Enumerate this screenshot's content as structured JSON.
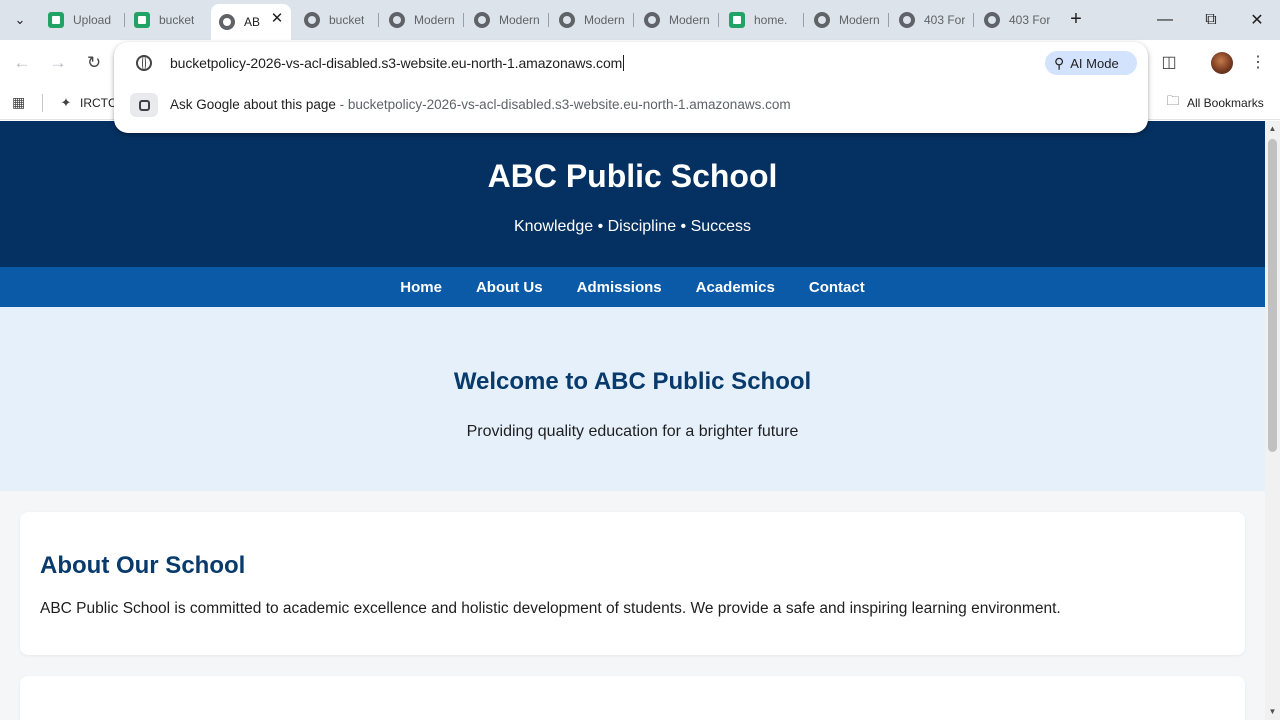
{
  "tabs": [
    {
      "label": "Upload",
      "favicon": "sheet-icon"
    },
    {
      "label": "bucket",
      "favicon": "sheet-icon"
    },
    {
      "label": "AB",
      "favicon": "globe-icon",
      "active": true
    },
    {
      "label": "bucket",
      "favicon": "globe-icon"
    },
    {
      "label": "Modern",
      "favicon": "globe-icon"
    },
    {
      "label": "Modern",
      "favicon": "globe-icon"
    },
    {
      "label": "Modern",
      "favicon": "globe-icon"
    },
    {
      "label": "Modern",
      "favicon": "globe-icon"
    },
    {
      "label": "home.",
      "favicon": "sheet-icon"
    },
    {
      "label": "Modern",
      "favicon": "globe-icon"
    },
    {
      "label": "403 For",
      "favicon": "globe-icon"
    },
    {
      "label": "403 For",
      "favicon": "globe-icon"
    }
  ],
  "omnibox": {
    "url": "bucketpolicy-2026-vs-acl-disabled.s3-website.eu-north-1.amazonaws.com",
    "ai_mode_label": "AI Mode",
    "suggestion_prefix": "Ask Google about this page",
    "suggestion_separator": " - ",
    "suggestion_url": "bucketpolicy-2026-vs-acl-disabled.s3-website.eu-north-1.amazonaws.com"
  },
  "bookmarks": {
    "items": [
      {
        "label": "IRCTC"
      }
    ],
    "all_bookmarks_label": "All Bookmarks"
  },
  "page": {
    "header": {
      "title": "ABC Public School",
      "tagline": "Knowledge • Discipline • Success"
    },
    "nav": [
      "Home",
      "About Us",
      "Admissions",
      "Academics",
      "Contact"
    ],
    "hero": {
      "title": "Welcome to ABC Public School",
      "subtitle": "Providing quality education for a brighter future"
    },
    "about": {
      "title": "About Our School",
      "text": "ABC Public School is committed to academic excellence and holistic development of students. We provide a safe and inspiring learning environment."
    }
  },
  "colors": {
    "header_bg": "#053162",
    "nav_bg": "#0a5aa8",
    "hero_bg": "#e6f0fb",
    "heading": "#083a6b",
    "tabstrip_bg": "#dde3ea",
    "ai_mode_bg": "#d3e3fd"
  }
}
